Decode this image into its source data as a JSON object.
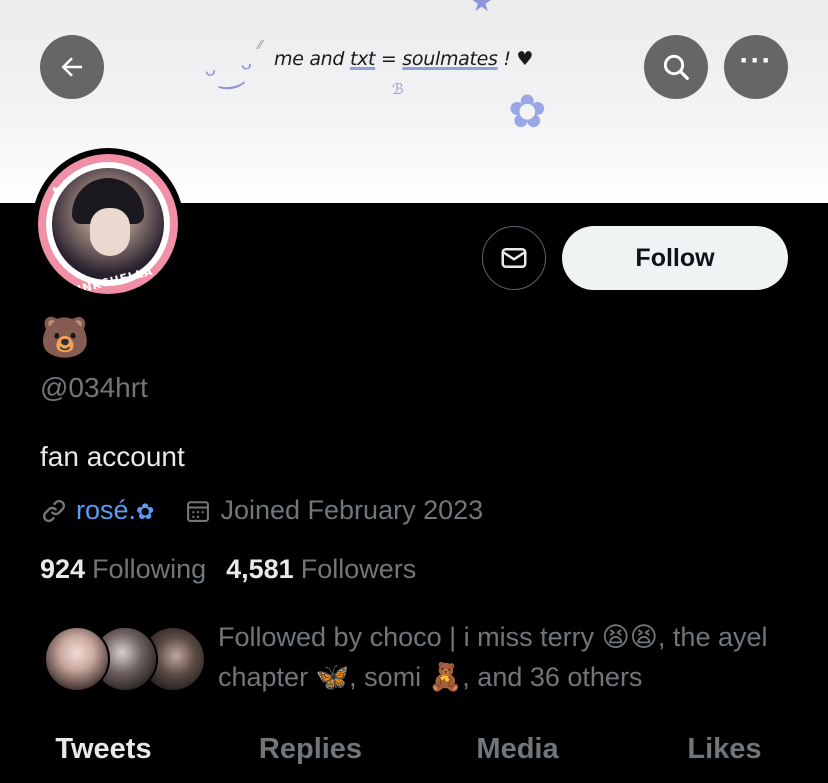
{
  "banner": {
    "text_prefix": "me and ",
    "text_txt": "txt",
    "text_eq": " = ",
    "text_soulmates": "soulmates",
    "text_suffix": " ! ♥"
  },
  "header": {
    "back_icon": "←",
    "more_icon": "···"
  },
  "avatar": {
    "ring_text": "PINKCHELLA"
  },
  "actions": {
    "follow_label": "Follow"
  },
  "profile": {
    "display_name": "🐻",
    "handle": "@034hrt",
    "bio": "fan account",
    "website": "rosé.",
    "website_flower": "✿",
    "joined": "Joined February 2023",
    "following_count": "924",
    "following_label": "Following",
    "followers_count": "4,581",
    "followers_label": "Followers"
  },
  "followed_by": {
    "text": "Followed by choco | i miss terry 😫😫, the ayel chapter 🦋, somi 🧸, and 36 others"
  },
  "tabs": [
    {
      "label": "Tweets",
      "active": true
    },
    {
      "label": "Replies",
      "active": false
    },
    {
      "label": "Media",
      "active": false
    },
    {
      "label": "Likes",
      "active": false
    }
  ],
  "colors": {
    "background": "#000000",
    "link": "#5b9cf2",
    "secondary_text": "#71767b",
    "avatar_ring": "#f08fa6"
  }
}
